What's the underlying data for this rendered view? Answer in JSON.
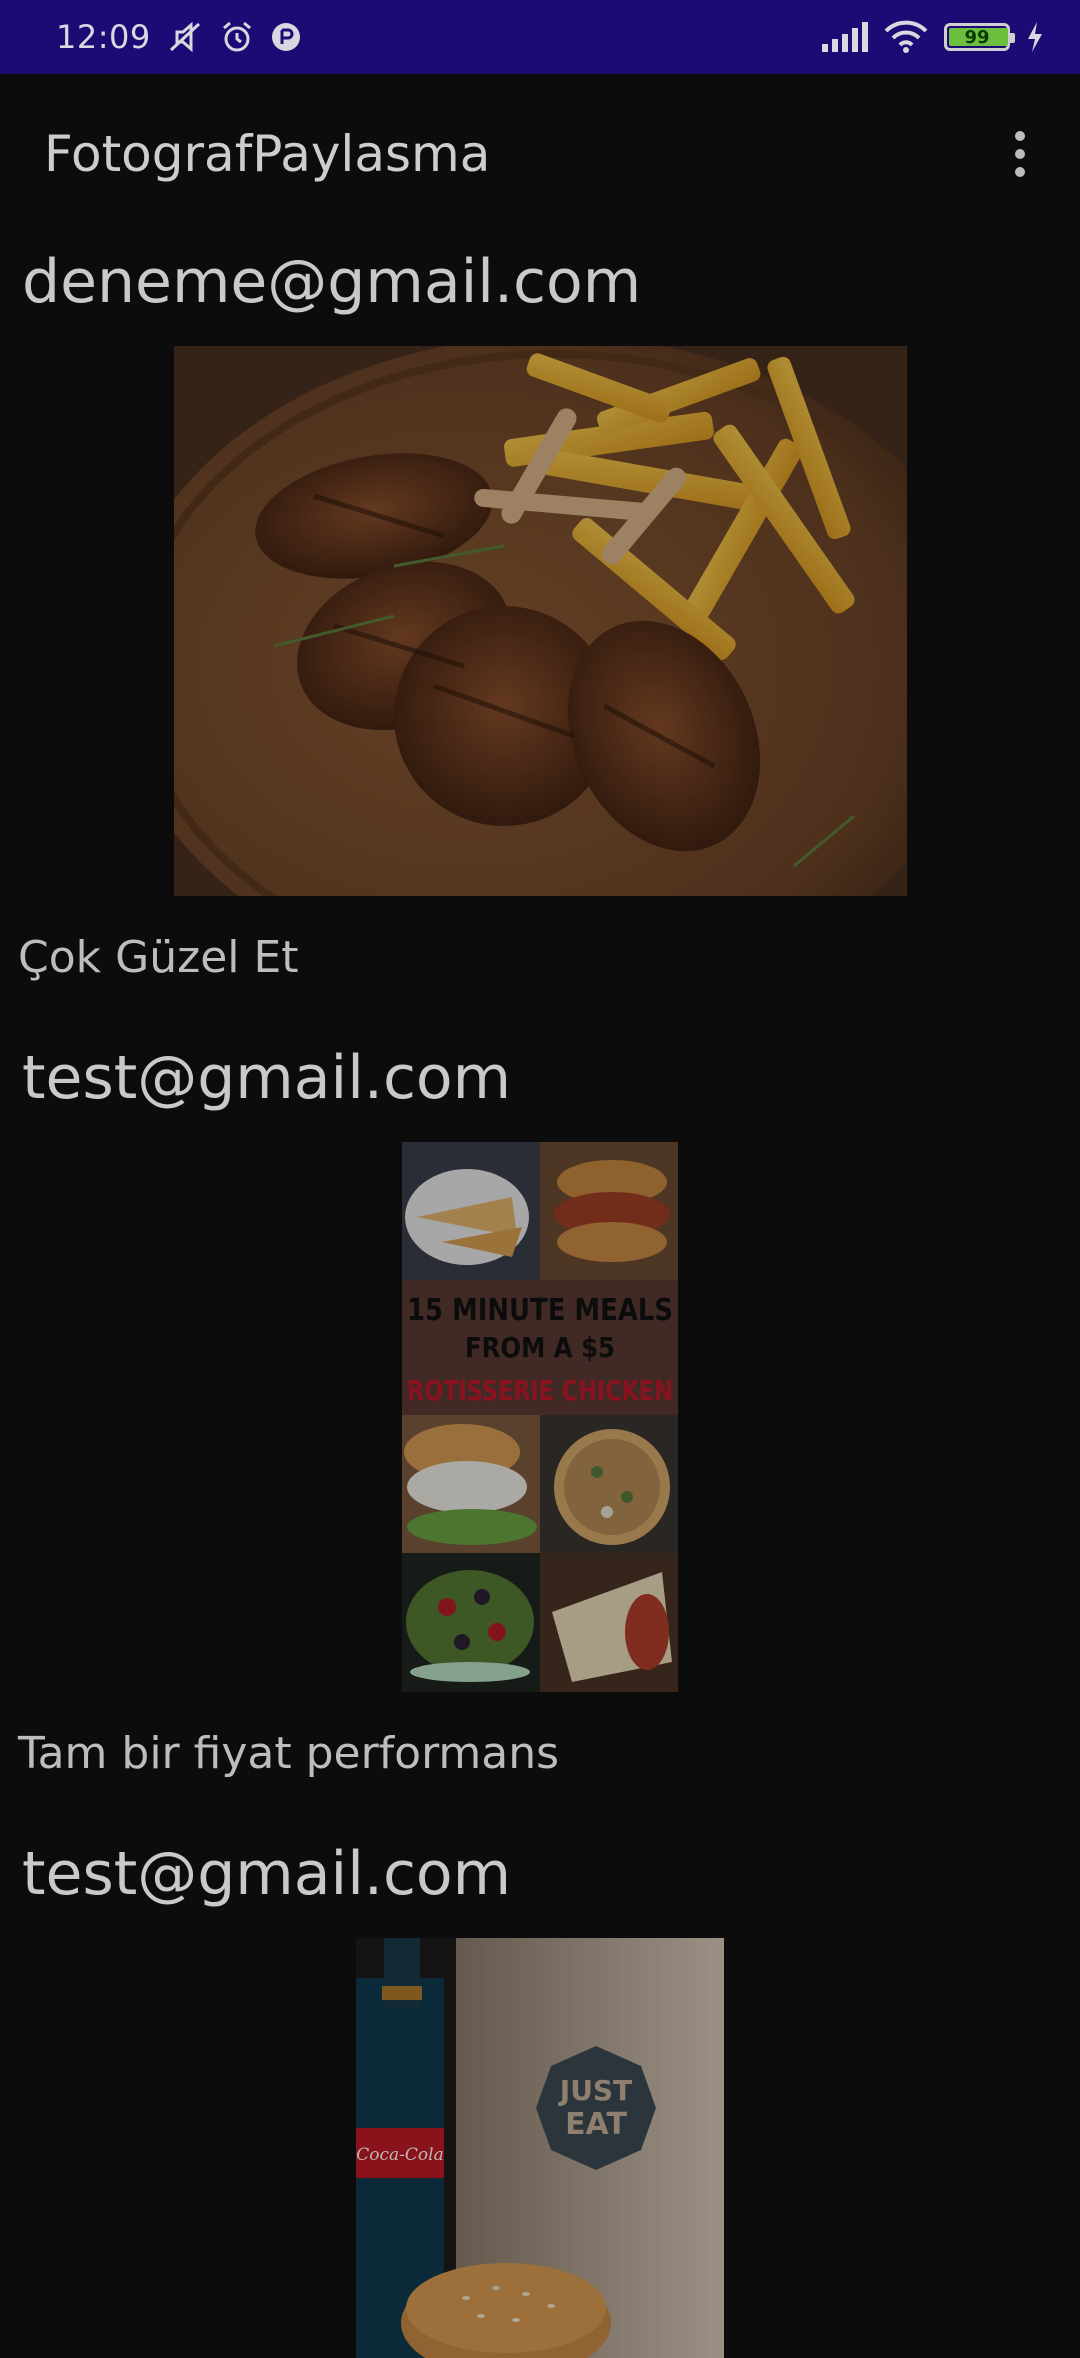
{
  "status_bar": {
    "time": "12:09",
    "battery_level": "99",
    "icons": [
      "mute-icon",
      "alarm-icon",
      "app-notification-icon",
      "signal-icon",
      "wifi-icon",
      "battery-icon",
      "charging-icon"
    ]
  },
  "app_bar": {
    "title": "FotografPaylasma",
    "menu_icon": "more-vert-icon"
  },
  "posts": [
    {
      "email": "deneme@gmail.com",
      "caption": "Çok Güzel Et",
      "image": "grilled-lamb-chops-with-fries-photo"
    },
    {
      "email": "test@gmail.com",
      "caption": "Tam bir fiyat performans",
      "image": "rotisserie-chicken-meals-collage-photo",
      "image_text": {
        "line1": "15 MINUTE MEALS",
        "line2": "FROM A $5",
        "line3": "ROTISSERIE CHICKEN"
      }
    },
    {
      "email": "test@gmail.com",
      "caption": "",
      "image": "coca-cola-bottle-and-burger-with-just-eat-bag-photo",
      "image_text": {
        "bottle": "Coca-Cola",
        "bag_line1": "JUST",
        "bag_line2": "EAT"
      }
    }
  ],
  "colors": {
    "status_bar": "#1e0a74",
    "background": "#0c0c0d",
    "text_primary": "#c9c9c9"
  }
}
